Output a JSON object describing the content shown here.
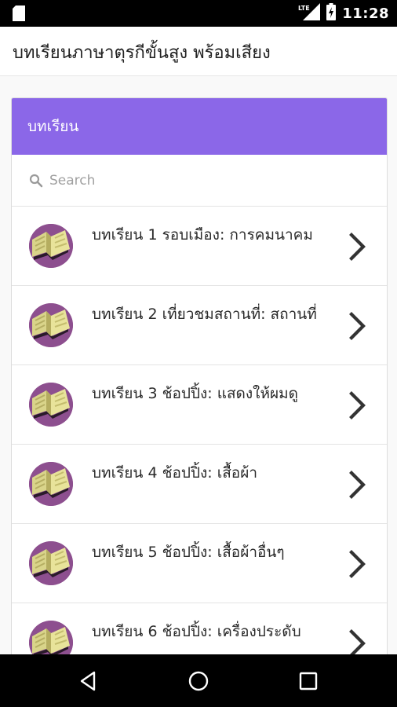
{
  "status_bar": {
    "time": "11:28",
    "network": "LTE",
    "icons": [
      "sd-card-icon",
      "lte-signal-icon",
      "battery-charging-icon"
    ]
  },
  "app_bar": {
    "title": "บทเรียนภาษาตุรกีขั้นสูง พร้อมเสียง"
  },
  "card": {
    "header": "บทเรียน",
    "header_color": "#8b67e8",
    "search": {
      "placeholder": "Search"
    },
    "lessons": [
      {
        "label": "บทเรียน 1 รอบเมือง: การคมนาคม"
      },
      {
        "label": "บทเรียน 2 เที่ยวชมสถานที่: สถานที่"
      },
      {
        "label": "บทเรียน 3 ช้อปปิ้ง: แสดงให้ผมดู"
      },
      {
        "label": "บทเรียน 4 ช้อปปิ้ง: เสื้อผ้า"
      },
      {
        "label": "บทเรียน 5 ช้อปปิ้ง: เสื้อผ้าอื่นๆ"
      },
      {
        "label": "บทเรียน 6 ช้อปปิ้ง: เครื่องประดับ"
      }
    ],
    "lesson_icon": "open-book-icon",
    "item_action_icon": "chevron-right-icon"
  },
  "nav_bar": {
    "buttons": [
      "back-icon",
      "home-icon",
      "recents-icon"
    ]
  }
}
